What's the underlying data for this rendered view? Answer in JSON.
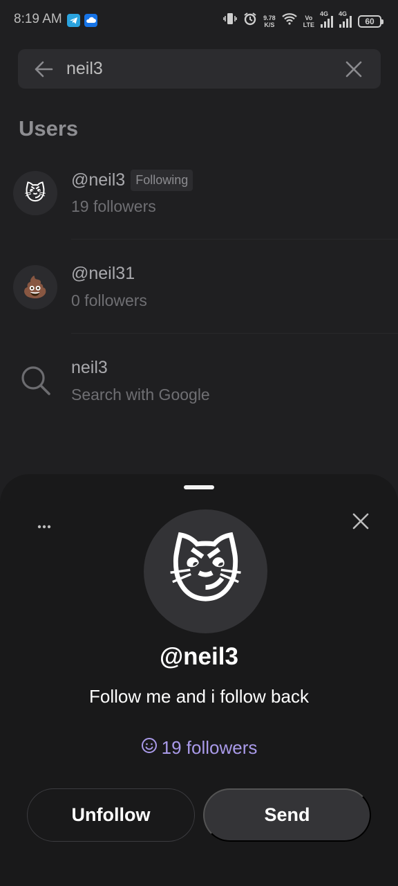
{
  "status_bar": {
    "time": "8:19 AM",
    "net_speed_value": "9.78",
    "net_speed_unit": "K/S",
    "volte_top": "Vo",
    "volte_bottom": "LTE",
    "sim1_label": "4G",
    "sim2_label": "4G",
    "battery": "60",
    "icons": [
      "telegram-icon",
      "cloud-icon",
      "vibrate-icon",
      "alarm-icon",
      "wifi-icon",
      "signal-icon",
      "battery-icon"
    ]
  },
  "search": {
    "query": "neil3"
  },
  "results": {
    "section_title": "Users",
    "users": [
      {
        "handle": "@neil3",
        "badge": "Following",
        "followers": "19 followers",
        "avatar_emoji": "😼"
      },
      {
        "handle": "@neil31",
        "badge": "",
        "followers": "0 followers",
        "avatar_emoji": "💩"
      }
    ],
    "web_search": {
      "query": "neil3",
      "label": "Search with Google"
    }
  },
  "profile_sheet": {
    "avatar_emoji": "😼",
    "username": "@neil3",
    "bio": "Follow me and i follow back",
    "followers": "19 followers",
    "unfollow_label": "Unfollow",
    "send_label": "Send"
  },
  "colors": {
    "sheet_bg": "#19191a",
    "screen_bg": "#1f1f21",
    "accent": "#a99ae9",
    "button_send_bg": "#343437"
  }
}
